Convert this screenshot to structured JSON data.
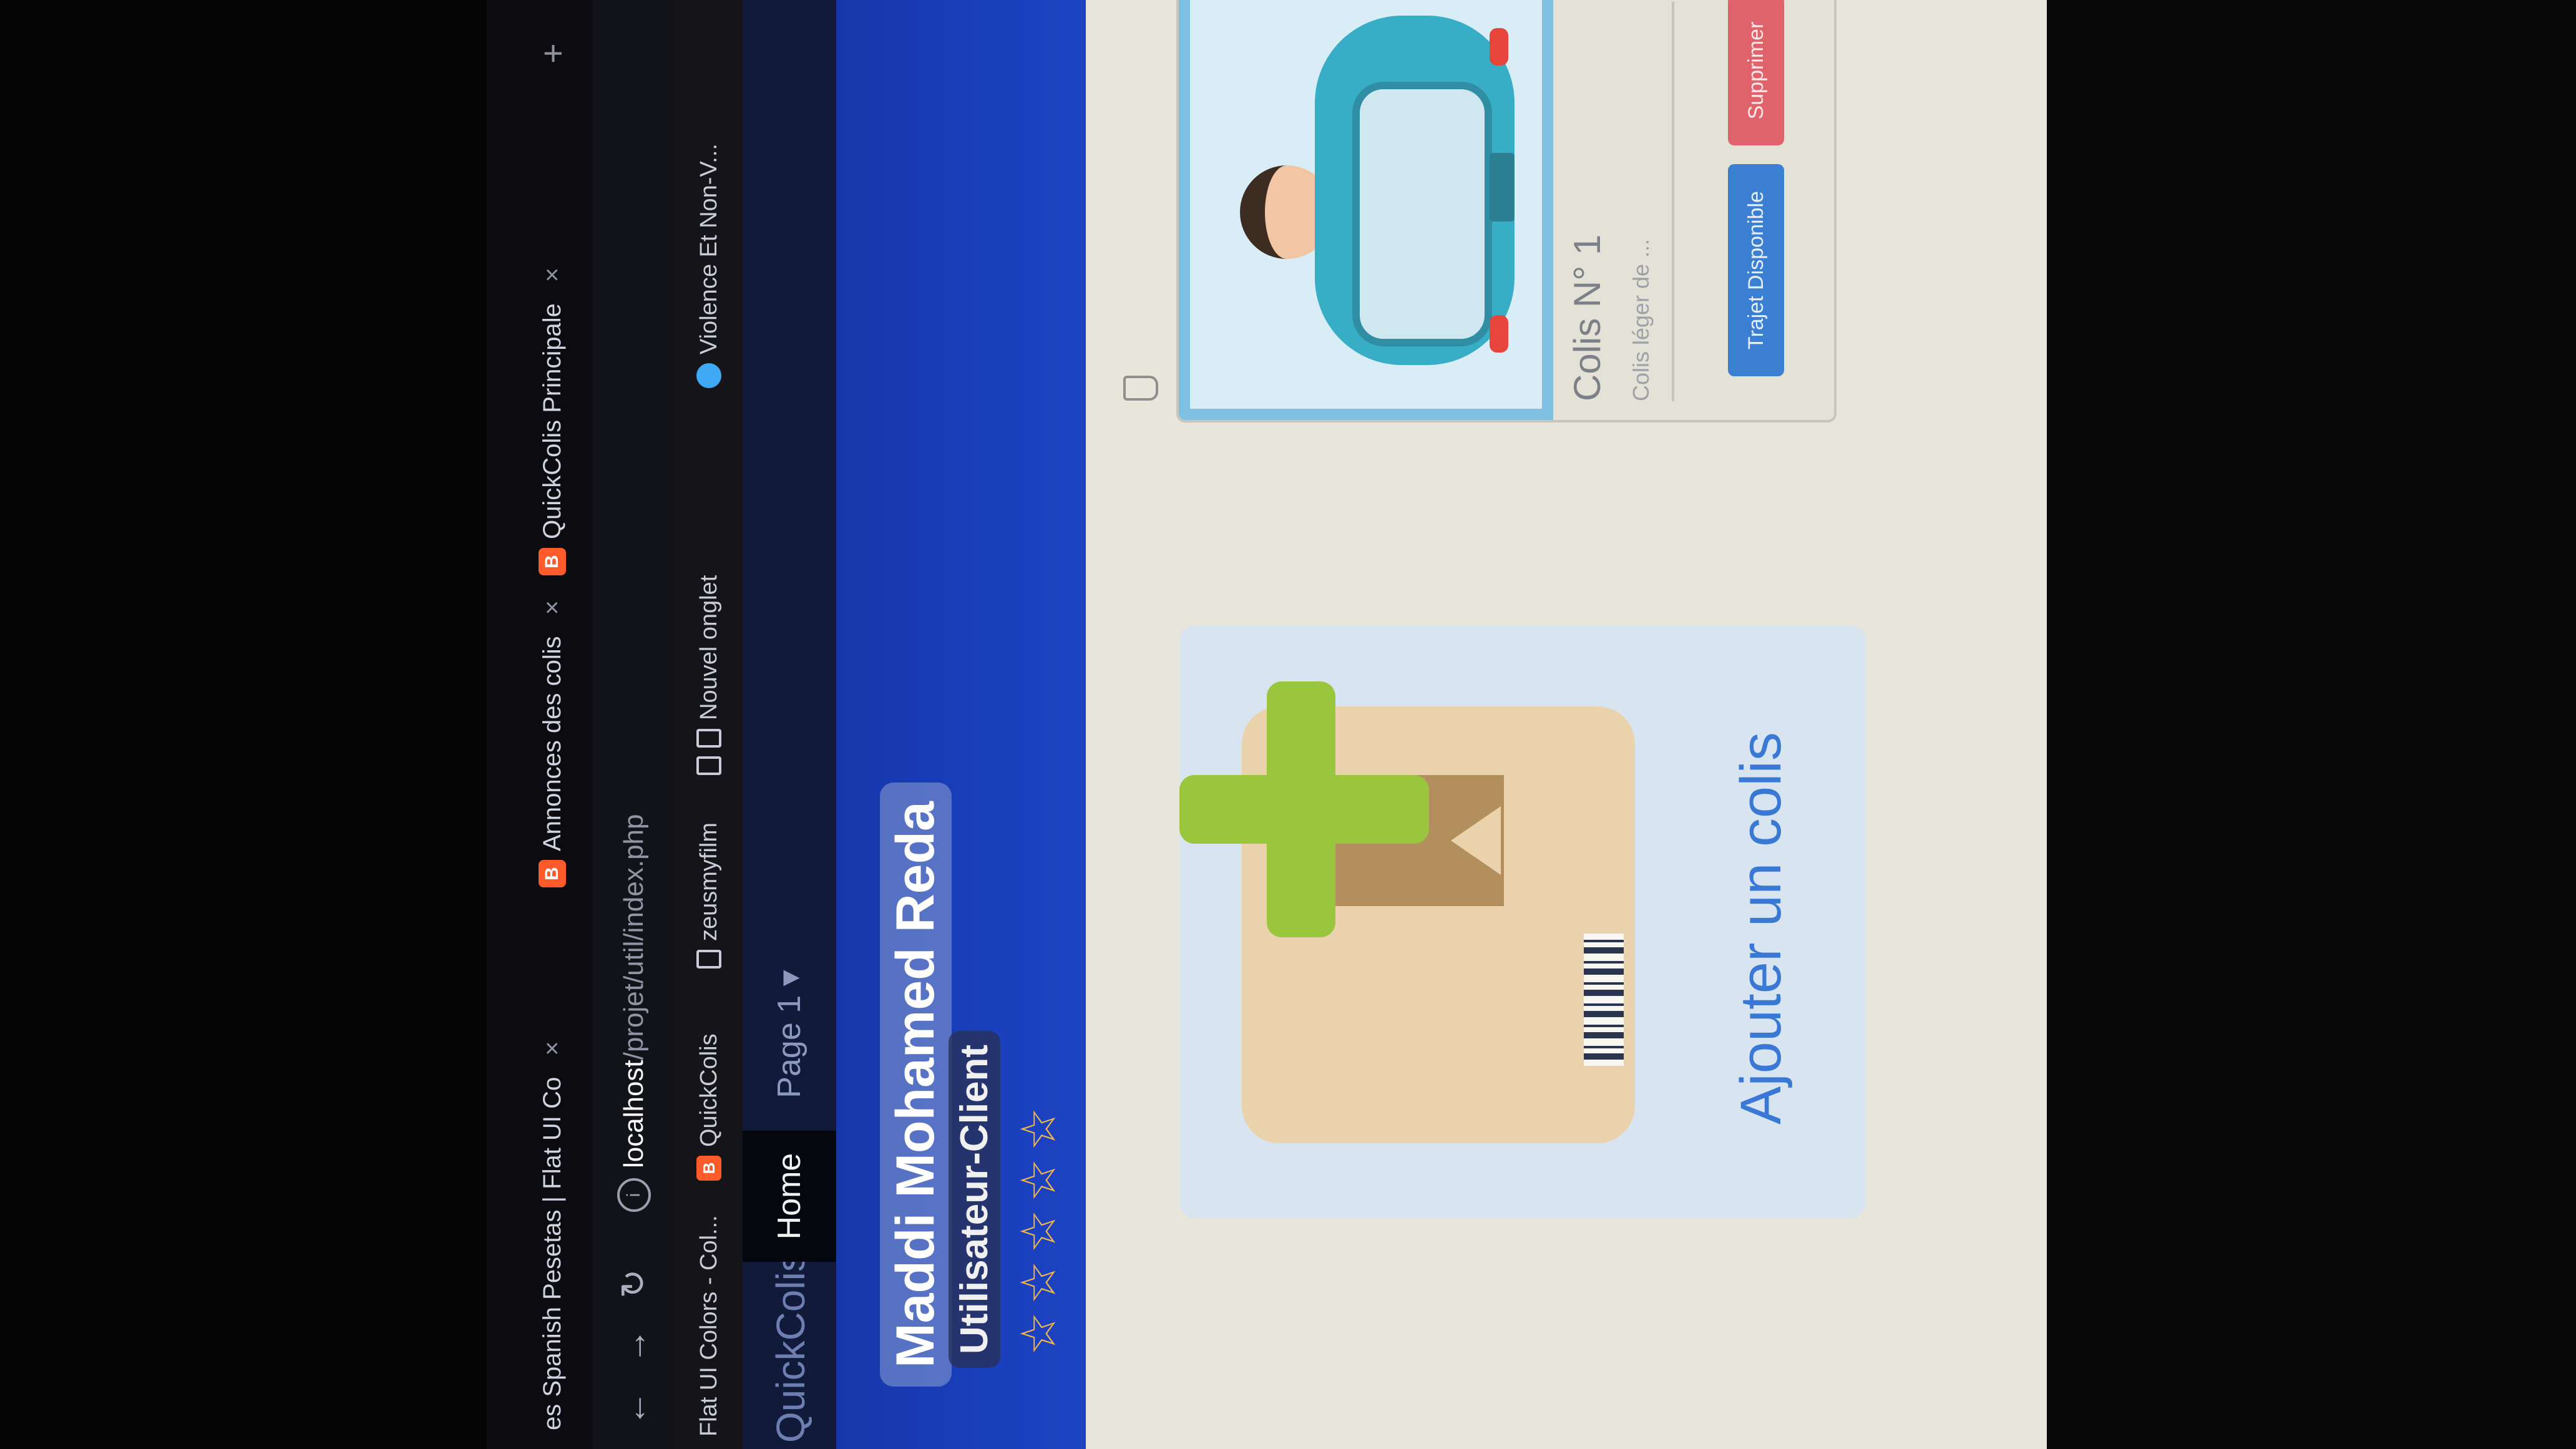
{
  "browser": {
    "tabs": [
      {
        "label": "es Spanish Pesetas | Flat UI Co",
        "favicon": ""
      },
      {
        "label": "Annonces des colis",
        "favicon": "B"
      },
      {
        "label": "QuickColis Principale",
        "favicon": "B"
      }
    ],
    "new_tab": "+",
    "address": {
      "host": "localhost",
      "path": "/projet/util/index.php"
    },
    "bookmarks": [
      {
        "label": "Flat UI Colors - Col...",
        "icon": "doc-icon"
      },
      {
        "label": "QuickColis",
        "icon": "blogger-icon",
        "favicon": "B"
      },
      {
        "label": "zeusmyfilm",
        "icon": "doc-icon"
      },
      {
        "label": "Nouvel onglet",
        "icon": "doc-icon"
      },
      {
        "label": "Violence Et Non-V...",
        "icon": "globe-icon"
      }
    ]
  },
  "navbar": {
    "brand": "QuickColis",
    "items": [
      "Home",
      "Page 1 ▾"
    ]
  },
  "profile": {
    "name": "Maddi Mohamed Reda",
    "role": "Utilisateur-Client",
    "rating_stars": 5,
    "rating_filled": 0
  },
  "add_parcel": {
    "label": "Ajouter un colis"
  },
  "parcel": {
    "title": "Colis N° 1",
    "description": "Colis léger de ...",
    "buttons": {
      "trajet": "Trajet Disponible",
      "supprimer": "Supprimer"
    }
  },
  "colors": {
    "hero": "#1a3fbd",
    "nav_bg": "#121a3a",
    "link": "#3a78d6",
    "btn_primary": "#3b7fd2",
    "btn_danger": "#e0626b",
    "star": "#f3b64a"
  }
}
